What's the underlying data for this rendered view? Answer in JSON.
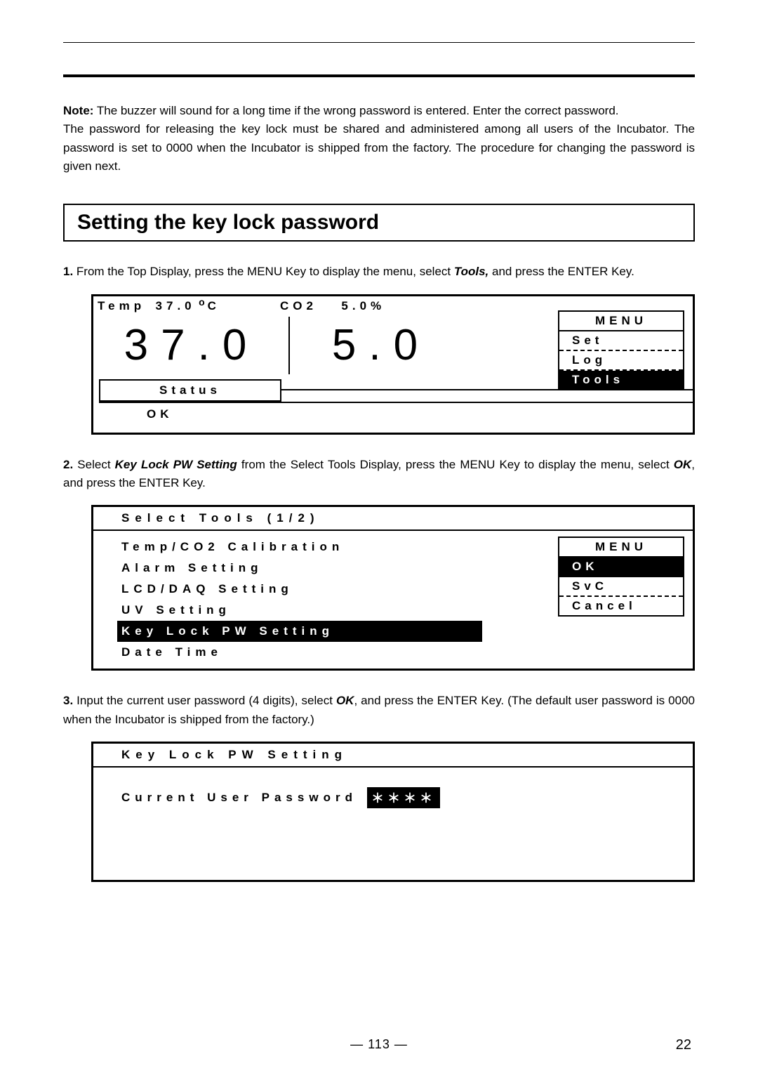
{
  "note": {
    "label": "Note:",
    "line1": " The buzzer will sound for a long time if the wrong password is entered. Enter the correct password.",
    "line2": "The password for releasing the key lock must be shared and administered among all users of the Incubator. The password is set to 0000 when the Incubator is shipped from the factory. The procedure for changing the password is given next."
  },
  "section_title": "Setting the key lock password",
  "step1": {
    "num": "1.",
    "text_a": " From the Top Display, press the MENU Key to display the menu, select ",
    "tools": "Tools,",
    "text_b": " and press the ENTER Key."
  },
  "panel1": {
    "temp_label": "Temp",
    "temp_val_small": "37.0",
    "temp_unit_deg": "o",
    "temp_unit_c": "C",
    "co2_label": "CO2",
    "co2_val_small": "5.0%",
    "big_temp": "37.0",
    "big_co2": "5.0",
    "menu_title": "MENU",
    "menu_set": "Set",
    "menu_log": "Log",
    "menu_tools": "Tools",
    "status": "Status",
    "ok": "OK"
  },
  "step2": {
    "num": "2.",
    "text_a": " Select ",
    "kl": "Key Lock PW Setting",
    "text_b": " from the Select Tools Display, press the MENU Key to display the menu, select ",
    "ok": "OK",
    "text_c": ", and press the ENTER Key."
  },
  "panel2": {
    "title": "Select Tools (1/2)",
    "items": [
      "Temp/CO2 Calibration",
      "Alarm Setting",
      "LCD/DAQ Setting",
      "UV Setting",
      "Key Lock PW Setting",
      "Date Time"
    ],
    "menu_title": "MENU",
    "menu_ok": "OK",
    "menu_svc": "SvC",
    "menu_cancel": "Cancel"
  },
  "step3": {
    "num": "3.",
    "text_a": " Input the current user password (4 digits), select ",
    "ok": "OK",
    "text_b": ", and press the ENTER Key. (The default user password is 0000 when the Incubator is shipped from the factory.)"
  },
  "panel3": {
    "title": "Key Lock PW Setting",
    "label": "Current User Password",
    "mask": "＊＊＊＊"
  },
  "footer": {
    "center": "― 113 ―",
    "right": "22"
  }
}
